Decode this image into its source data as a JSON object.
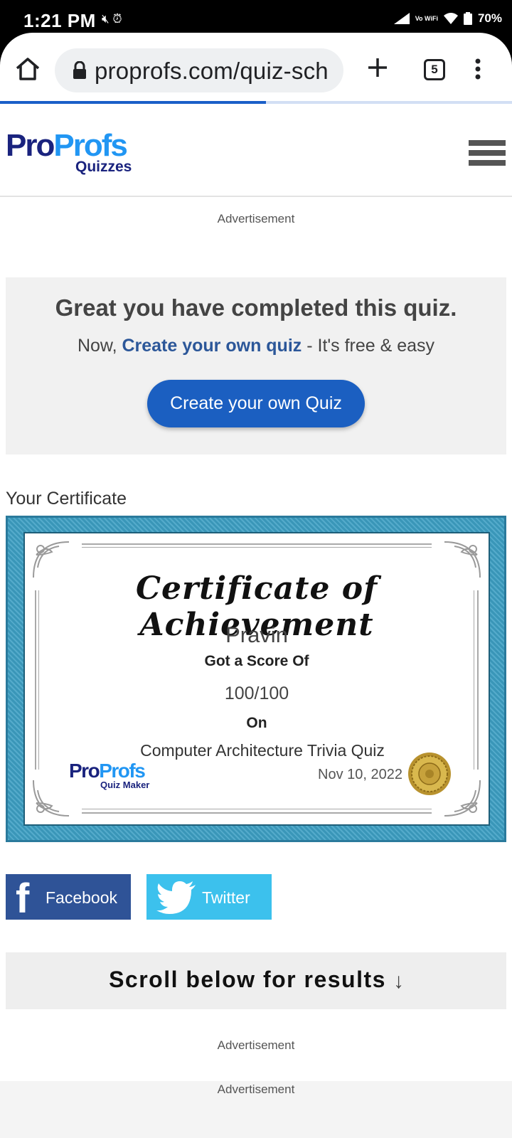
{
  "status_bar": {
    "time": "1:21 PM",
    "vowifi": "Vo WiFi",
    "battery": "70%"
  },
  "browser": {
    "url": "proprofs.com/quiz-sch",
    "tab_count": "5",
    "load_progress": 0.52
  },
  "header": {
    "logo_pro": "Pro",
    "logo_profs": "Profs",
    "logo_sub": "Quizzes"
  },
  "ads": {
    "top": "Advertisement",
    "mid": "Advertisement",
    "bottom": "Advertisement"
  },
  "completed": {
    "title": "Great you have completed this quiz.",
    "sub_prefix": "Now, ",
    "sub_link": "Create your own quiz",
    "sub_suffix": " - It's free & easy",
    "button": "Create your own Quiz"
  },
  "certificate": {
    "heading": "Your Certificate",
    "title": "Certificate of Achievement",
    "name": "Pravin",
    "got_score": "Got a Score Of",
    "score": "100/100",
    "on": "On",
    "quiz": "Computer Architecture Trivia Quiz",
    "logo_pro": "Pro",
    "logo_profs": "Profs",
    "logo_sub": "Quiz Maker",
    "date": "Nov 10, 2022"
  },
  "share": {
    "facebook": "Facebook",
    "twitter": "Twitter"
  },
  "scroll": {
    "text": "Scroll below for results",
    "arrow": "↓"
  },
  "colors": {
    "brand_dark": "#1a237e",
    "brand_light": "#2196f3",
    "button_blue": "#1b5fc1",
    "facebook": "#2f5397",
    "twitter": "#3cc1ed"
  }
}
